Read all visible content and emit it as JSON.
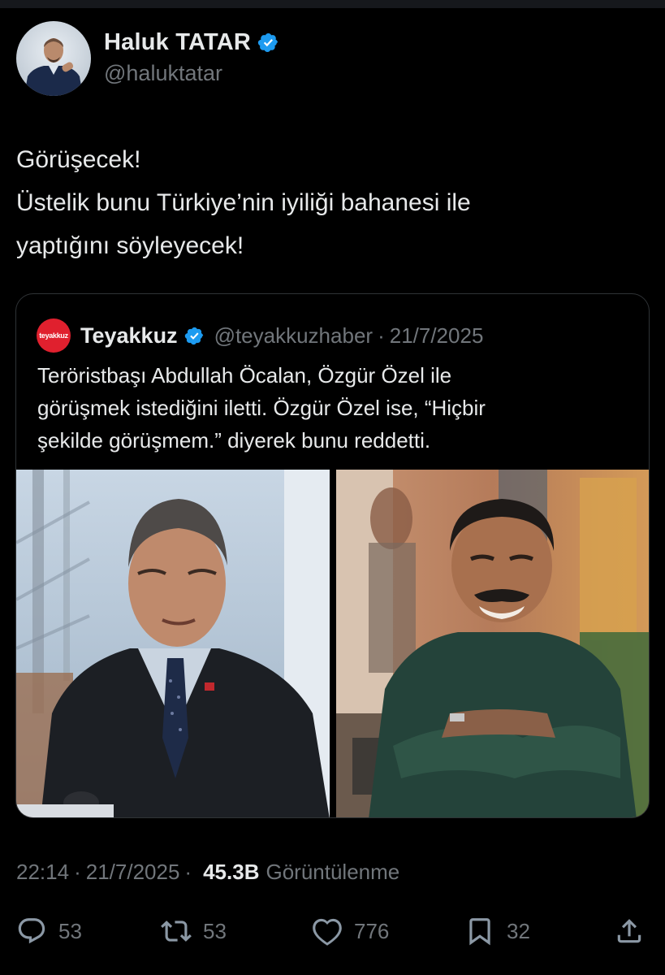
{
  "author": {
    "name": "Haluk TATAR",
    "handle": "@haluktatar",
    "verified": true
  },
  "tweet": {
    "lines": [
      "Görüşecek!",
      "Üstelik bunu Türkiye’nin iyiliği bahanesi ile",
      "yaptığını söyleyecek!"
    ]
  },
  "quote": {
    "logo_text": "teyakkuz",
    "name": "Teyakkuz",
    "handle": "@teyakkuzhaber",
    "separator": "·",
    "date": "21/7/2025",
    "lines": [
      "Teröristbaşı Abdullah Öcalan, Özgür Özel ile",
      "görüşmek istediğini iletti. Özgür Özel ise, “Hiçbir",
      "şekilde görüşmem.” diyerek bunu reddetti."
    ]
  },
  "meta": {
    "time": "22:14",
    "date": "21/7/2025",
    "separator": "·",
    "views": "45.3B",
    "views_label": "Görüntülenme"
  },
  "actions": {
    "replies": "53",
    "reposts": "53",
    "likes": "776",
    "bookmarks": "32"
  },
  "colors": {
    "background": "#000000",
    "text": "#e7e9ea",
    "muted": "#71767b",
    "verified_blue": "#1d9bf0",
    "border": "#2f3336",
    "logo_red": "#e0202e"
  },
  "icons": [
    "verified-badge-icon",
    "reply-icon",
    "repost-icon",
    "like-icon",
    "bookmark-icon",
    "share-icon"
  ]
}
